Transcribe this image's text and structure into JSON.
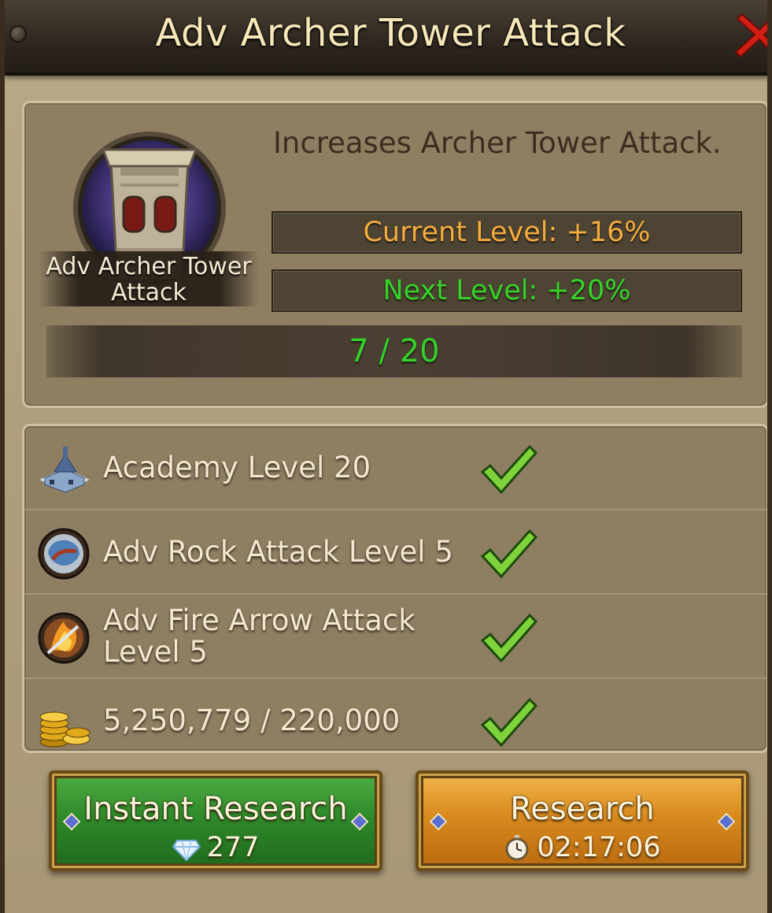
{
  "dialog": {
    "title": "Adv Archer Tower Attack"
  },
  "research": {
    "icon_name": "archer-tower-icon",
    "icon_label": "Adv Archer Tower Attack",
    "description": "Increases Archer Tower Attack.",
    "current_level": "Current Level: +16%",
    "next_level": "Next Level: +20%",
    "progress_text": "7 / 20",
    "progress_fraction": 0.35
  },
  "requirements": [
    {
      "icon": "academy-icon",
      "text": "Academy Level 20",
      "met": true
    },
    {
      "icon": "rock-attack-icon",
      "text": "Adv Rock Attack Level 5",
      "met": true
    },
    {
      "icon": "fire-arrow-icon",
      "text": "Adv Fire Arrow Attack Level 5",
      "met": true
    },
    {
      "icon": "gold-coins-icon",
      "text": "5,250,779 / 220,000",
      "met": true
    }
  ],
  "buttons": {
    "instant": {
      "label": "Instant Research",
      "cost": "277",
      "cost_icon": "diamond-icon"
    },
    "research": {
      "label": "Research",
      "time": "02:17:06",
      "time_icon": "stopwatch-icon"
    }
  },
  "colors": {
    "current_level": "#f4ad3e",
    "next_level": "#35d42a",
    "instant_button": "#2f8a2a",
    "research_button": "#d98a1e"
  }
}
